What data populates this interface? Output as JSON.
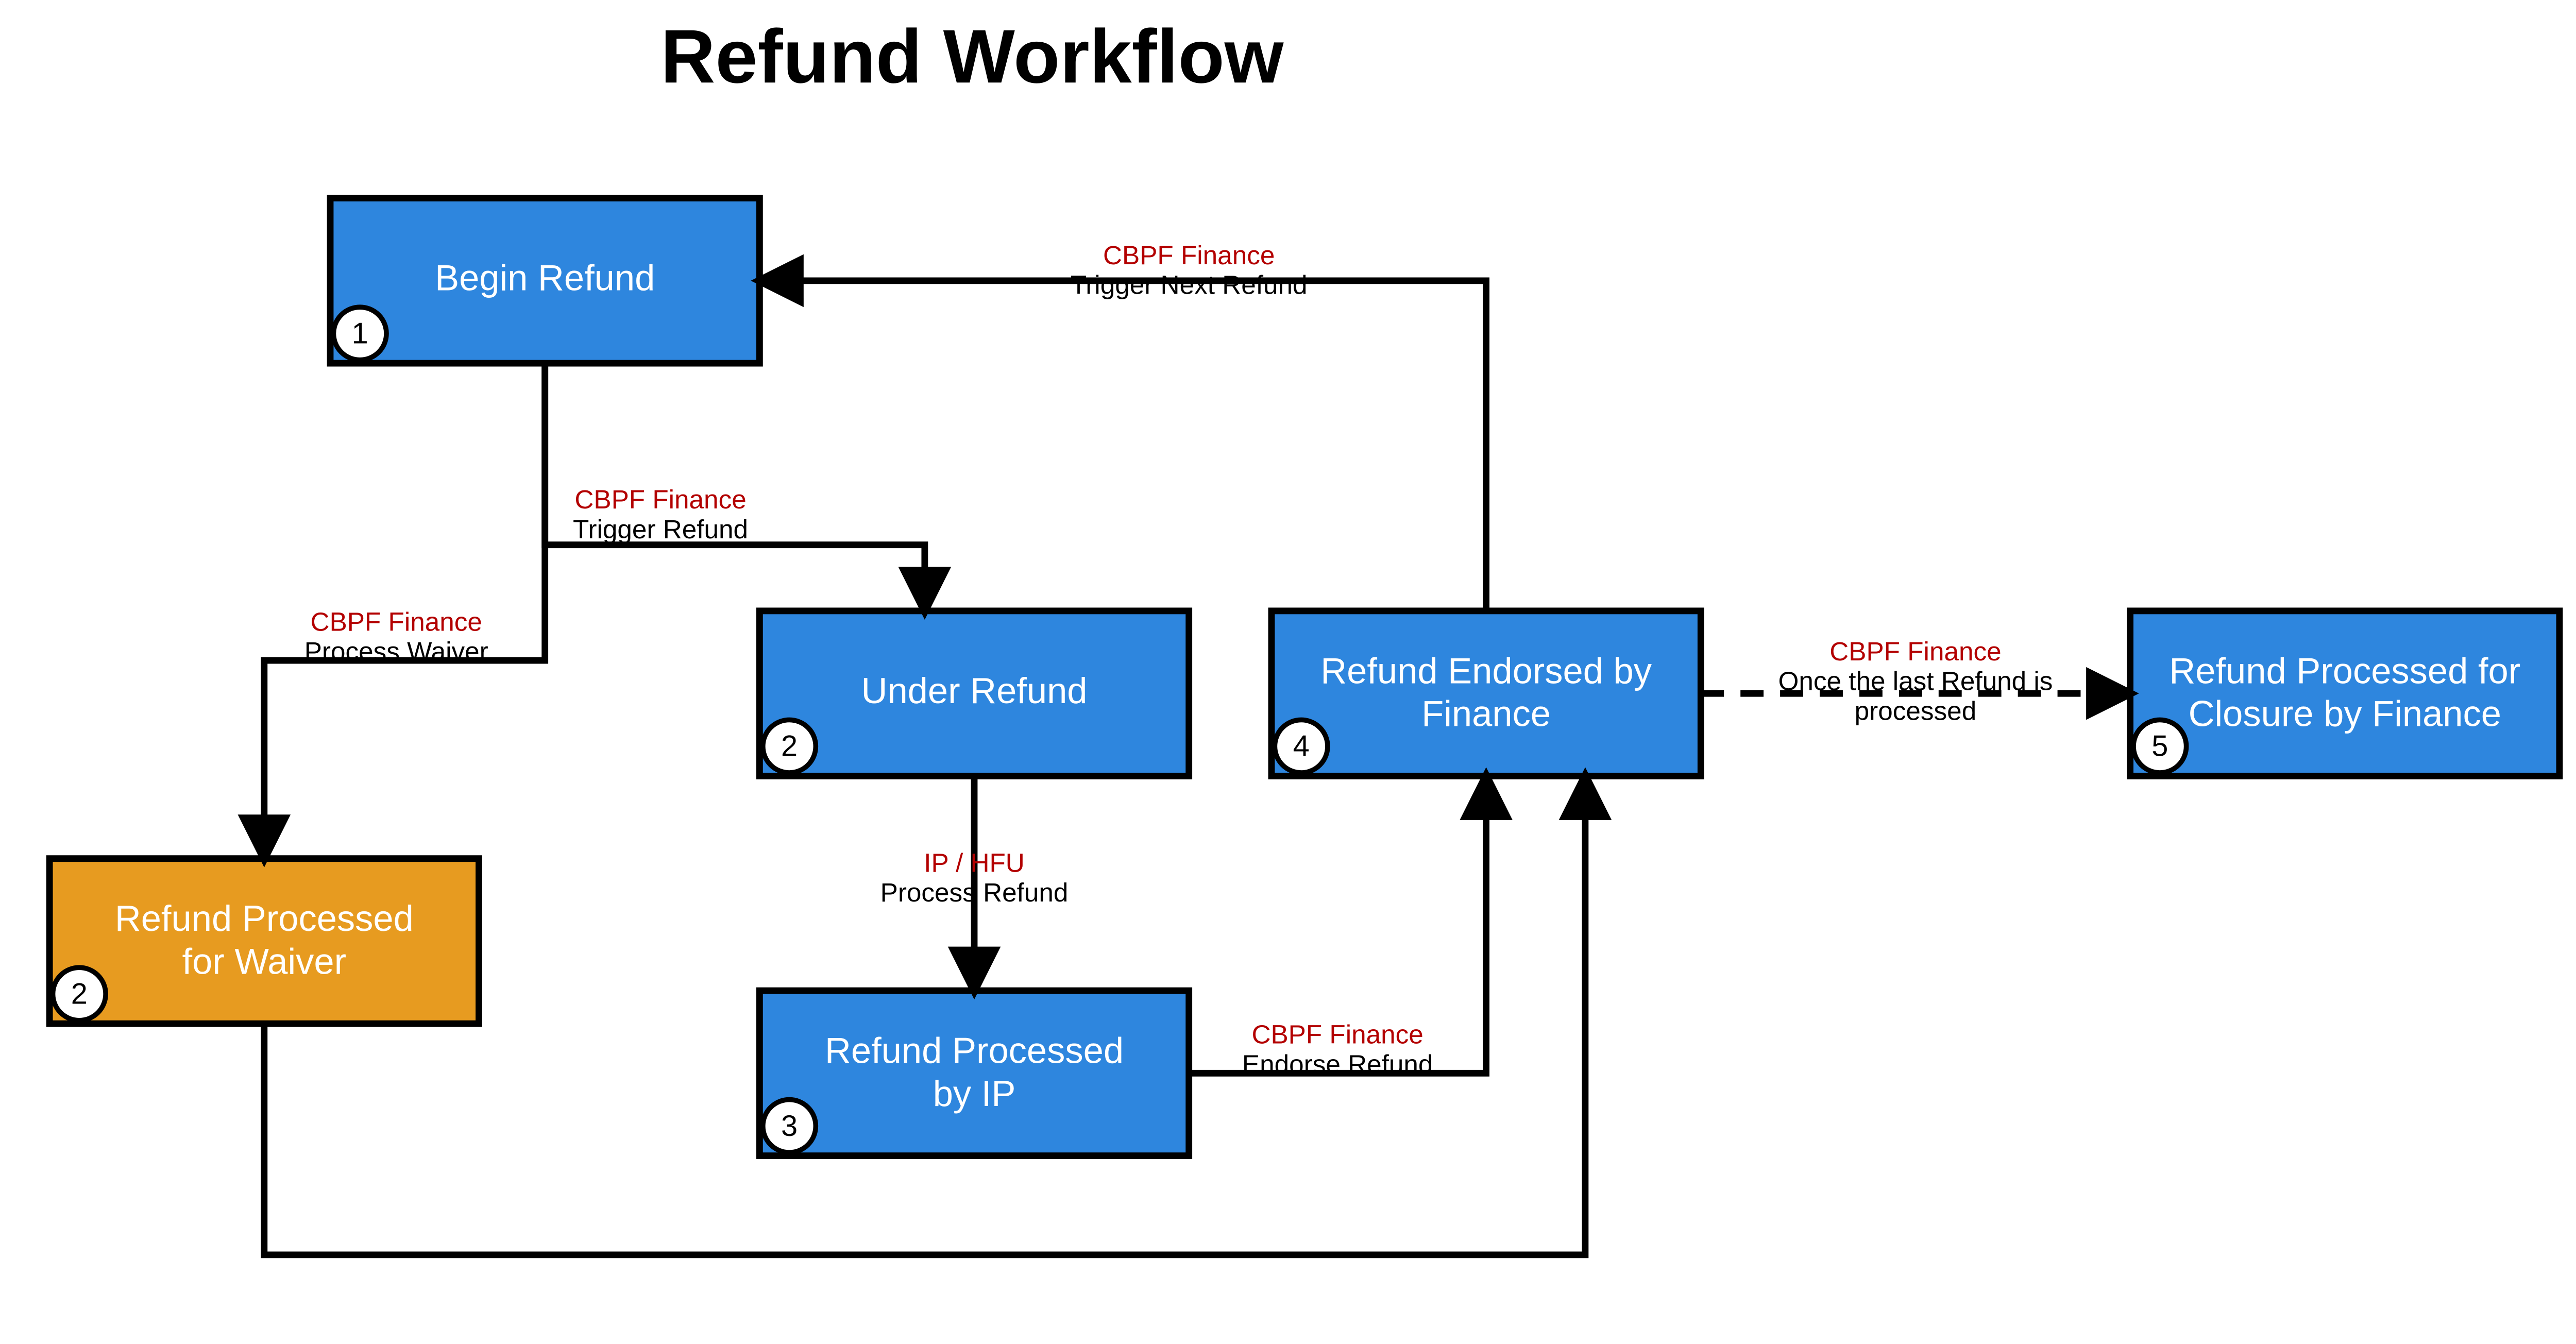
{
  "title": "Refund Workflow",
  "nodes": {
    "begin": {
      "num": "1",
      "label1": "Begin Refund",
      "label2": ""
    },
    "under": {
      "num": "2",
      "label1": "Under Refund",
      "label2": ""
    },
    "waiver": {
      "num": "2",
      "label1": "Refund Processed",
      "label2": "for Waiver"
    },
    "byip": {
      "num": "3",
      "label1": "Refund Processed",
      "label2": "by IP"
    },
    "endorsed": {
      "num": "4",
      "label1": "Refund Endorsed by",
      "label2": "Finance"
    },
    "closure": {
      "num": "5",
      "label1": "Refund Processed for",
      "label2": "Closure by Finance"
    }
  },
  "edges": {
    "trigger_refund": {
      "role": "CBPF Finance",
      "action": "Trigger Refund"
    },
    "process_waiver": {
      "role": "CBPF Finance",
      "action": "Process Waiver"
    },
    "process_refund": {
      "role": "IP / HFU",
      "action": "Process Refund"
    },
    "endorse_refund": {
      "role": "CBPF Finance",
      "action": "Endorse Refund"
    },
    "trigger_next_refund": {
      "role": "CBPF Finance",
      "action": "Trigger Next Refund"
    },
    "last_refund": {
      "role": "CBPF Finance",
      "action1": "Once the last Refund is",
      "action2": "processed"
    }
  }
}
